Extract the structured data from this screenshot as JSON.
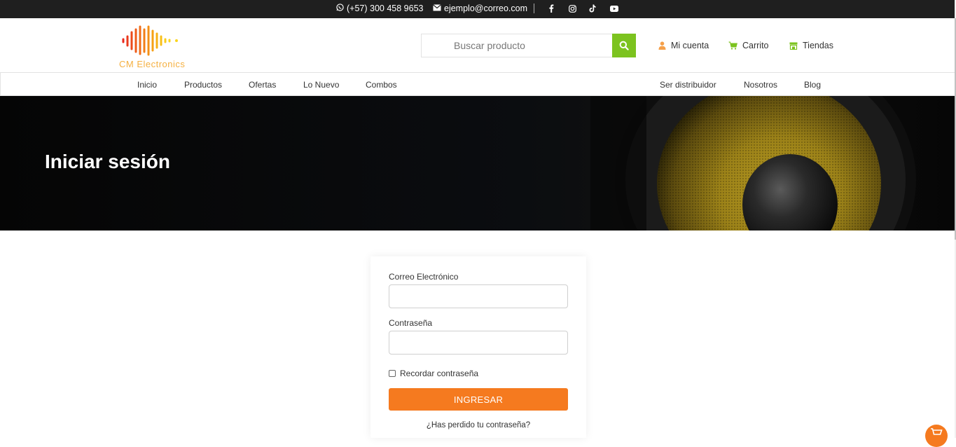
{
  "topbar": {
    "phone": "(+57) 300 458 9653",
    "email": "ejemplo@correo.com",
    "social_icons": [
      "facebook-icon",
      "instagram-icon",
      "tiktok-icon",
      "youtube-icon"
    ]
  },
  "header": {
    "logo_text": "CM Electronics",
    "search_placeholder": "Buscar producto",
    "links": {
      "account": "Mi cuenta",
      "cart": "Carrito",
      "stores": "Tiendas"
    }
  },
  "nav": {
    "left": [
      "Inicio",
      "Productos",
      "Ofertas",
      "Lo Nuevo",
      "Combos"
    ],
    "right": [
      "Ser distribuidor",
      "Nosotros",
      "Blog"
    ]
  },
  "hero": {
    "title": "Iniciar sesión"
  },
  "login_form": {
    "email_label": "Correo Electrónico",
    "email_value": "",
    "password_label": "Contraseña",
    "password_value": "",
    "remember_label": "Recordar contraseña",
    "remember_checked": false,
    "submit_label": "INGRESAR",
    "forgot_link": "¿Has perdido tu contraseña?"
  },
  "colors": {
    "accent_orange": "#f57a1f",
    "accent_green": "#7cc31f",
    "topbar_bg": "#1f1f1f"
  }
}
